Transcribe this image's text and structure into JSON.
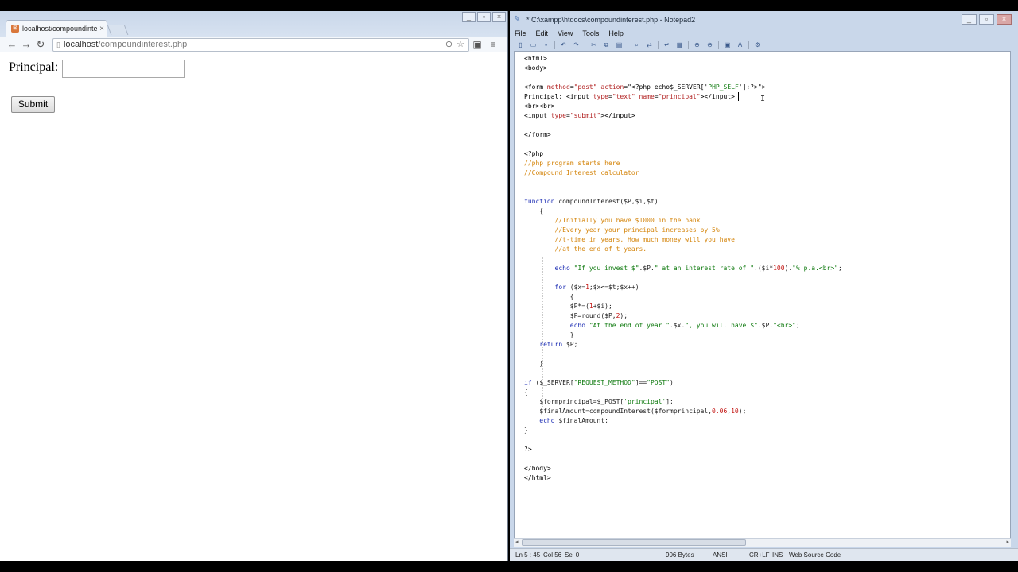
{
  "browser": {
    "tab_title": "localhost/compoundinter",
    "url_host": "localhost",
    "url_path": "/compoundinterest.php",
    "form": {
      "principal_label": "Principal:",
      "principal_value": "",
      "submit_label": "Submit"
    }
  },
  "notepad": {
    "title": "* C:\\xampp\\htdocs\\compoundinterest.php - Notepad2",
    "menu": [
      "File",
      "Edit",
      "View",
      "Tools",
      "Help"
    ],
    "status": {
      "position": "Ln 5 : 45",
      "col": "Col 56",
      "sel": "Sel 0",
      "size": "906 Bytes",
      "encoding": "ANSI",
      "eol": "CR+LF",
      "mode": "INS",
      "scheme": "Web Source Code"
    },
    "code_lines": [
      [
        [
          "t",
          "<html>"
        ]
      ],
      [
        [
          "t",
          "<body>"
        ]
      ],
      [],
      [
        [
          "t",
          "<form "
        ],
        [
          "a",
          "method"
        ],
        [
          "t",
          "="
        ],
        [
          "a",
          "\"post\""
        ],
        [
          "t",
          " "
        ],
        [
          "a",
          "action"
        ],
        [
          "t",
          "=\"<?php echo$_SERVER['"
        ],
        [
          "s",
          "PHP_SELF"
        ],
        [
          "t",
          "'];?>\">"
        ]
      ],
      [
        [
          "t",
          "Principal: <input "
        ],
        [
          "a",
          "type"
        ],
        [
          "t",
          "="
        ],
        [
          "a",
          "\"text\""
        ],
        [
          "t",
          " "
        ],
        [
          "a",
          "name"
        ],
        [
          "t",
          "="
        ],
        [
          "a",
          "\"principal\""
        ],
        [
          "t",
          "></input>"
        ]
      ],
      [
        [
          "t",
          "<br><br>"
        ]
      ],
      [
        [
          "t",
          "<input "
        ],
        [
          "a",
          "type"
        ],
        [
          "t",
          "="
        ],
        [
          "a",
          "\"submit\""
        ],
        [
          "t",
          "></input>"
        ]
      ],
      [],
      [
        [
          "t",
          "</form>"
        ]
      ],
      [],
      [
        [
          "t",
          "<?php"
        ]
      ],
      [
        [
          "c",
          "//php program starts here"
        ]
      ],
      [
        [
          "c",
          "//Compound Interest calculator"
        ]
      ],
      [],
      [],
      [
        [
          "k",
          "function"
        ],
        [
          "p",
          " compoundInterest($P,$i,$t)"
        ]
      ],
      [
        [
          "p",
          "    {"
        ]
      ],
      [
        [
          "c",
          "        //Initially you have $1000 in the bank"
        ]
      ],
      [
        [
          "c",
          "        //Every year your principal increases by 5%"
        ]
      ],
      [
        [
          "c",
          "        //t-time in years. How much money will you have"
        ]
      ],
      [
        [
          "c",
          "        //at the end of t years."
        ]
      ],
      [],
      [
        [
          "p",
          "        "
        ],
        [
          "k",
          "echo"
        ],
        [
          "p",
          " "
        ],
        [
          "s",
          "\"If you invest $\""
        ],
        [
          "p",
          ".$P."
        ],
        [
          "s",
          "\" at an interest rate of \""
        ],
        [
          "p",
          ".($i*"
        ],
        [
          "n",
          "100"
        ],
        [
          "p",
          ")."
        ],
        [
          "s",
          "\"% p.a.<br>\""
        ],
        [
          "p",
          ";"
        ]
      ],
      [],
      [
        [
          "p",
          "        "
        ],
        [
          "k",
          "for"
        ],
        [
          "p",
          " ($x="
        ],
        [
          "n",
          "1"
        ],
        [
          "p",
          ";$x<=$t;$x++)"
        ]
      ],
      [
        [
          "p",
          "            {"
        ]
      ],
      [
        [
          "p",
          "            $P*=("
        ],
        [
          "n",
          "1"
        ],
        [
          "p",
          "+$i);"
        ]
      ],
      [
        [
          "p",
          "            $P=round($P,"
        ],
        [
          "n",
          "2"
        ],
        [
          "p",
          ");"
        ]
      ],
      [
        [
          "p",
          "            "
        ],
        [
          "k",
          "echo"
        ],
        [
          "p",
          " "
        ],
        [
          "s",
          "\"At the end of year \""
        ],
        [
          "p",
          ".$x."
        ],
        [
          "s",
          "\", you will have $\""
        ],
        [
          "p",
          ".$P."
        ],
        [
          "s",
          "\"<br>\""
        ],
        [
          "p",
          ";"
        ]
      ],
      [
        [
          "p",
          "            }"
        ]
      ],
      [
        [
          "p",
          "    "
        ],
        [
          "k",
          "return"
        ],
        [
          "p",
          " $P;"
        ]
      ],
      [],
      [
        [
          "p",
          "    }"
        ]
      ],
      [],
      [
        [
          "k",
          "if"
        ],
        [
          "p",
          " ($_SERVER["
        ],
        [
          "s",
          "\"REQUEST_METHOD\""
        ],
        [
          "p",
          "]=="
        ],
        [
          "s",
          "\"POST\""
        ],
        [
          "p",
          ")"
        ]
      ],
      [
        [
          "p",
          "{"
        ]
      ],
      [
        [
          "p",
          "    $formprincipal=$_POST["
        ],
        [
          "s",
          "'principal'"
        ],
        [
          "p",
          "];"
        ]
      ],
      [
        [
          "p",
          "    $finalAmount=compoundInterest($formprincipal,"
        ],
        [
          "n",
          "0.06"
        ],
        [
          "p",
          ","
        ],
        [
          "n",
          "10"
        ],
        [
          "p",
          ");"
        ]
      ],
      [
        [
          "p",
          "    "
        ],
        [
          "k",
          "echo"
        ],
        [
          "p",
          " $finalAmount;"
        ]
      ],
      [
        [
          "p",
          "}"
        ]
      ],
      [],
      [
        [
          "t",
          "?>"
        ]
      ],
      [],
      [
        [
          "t",
          "</body>"
        ]
      ],
      [
        [
          "t",
          "</html>"
        ]
      ]
    ]
  }
}
